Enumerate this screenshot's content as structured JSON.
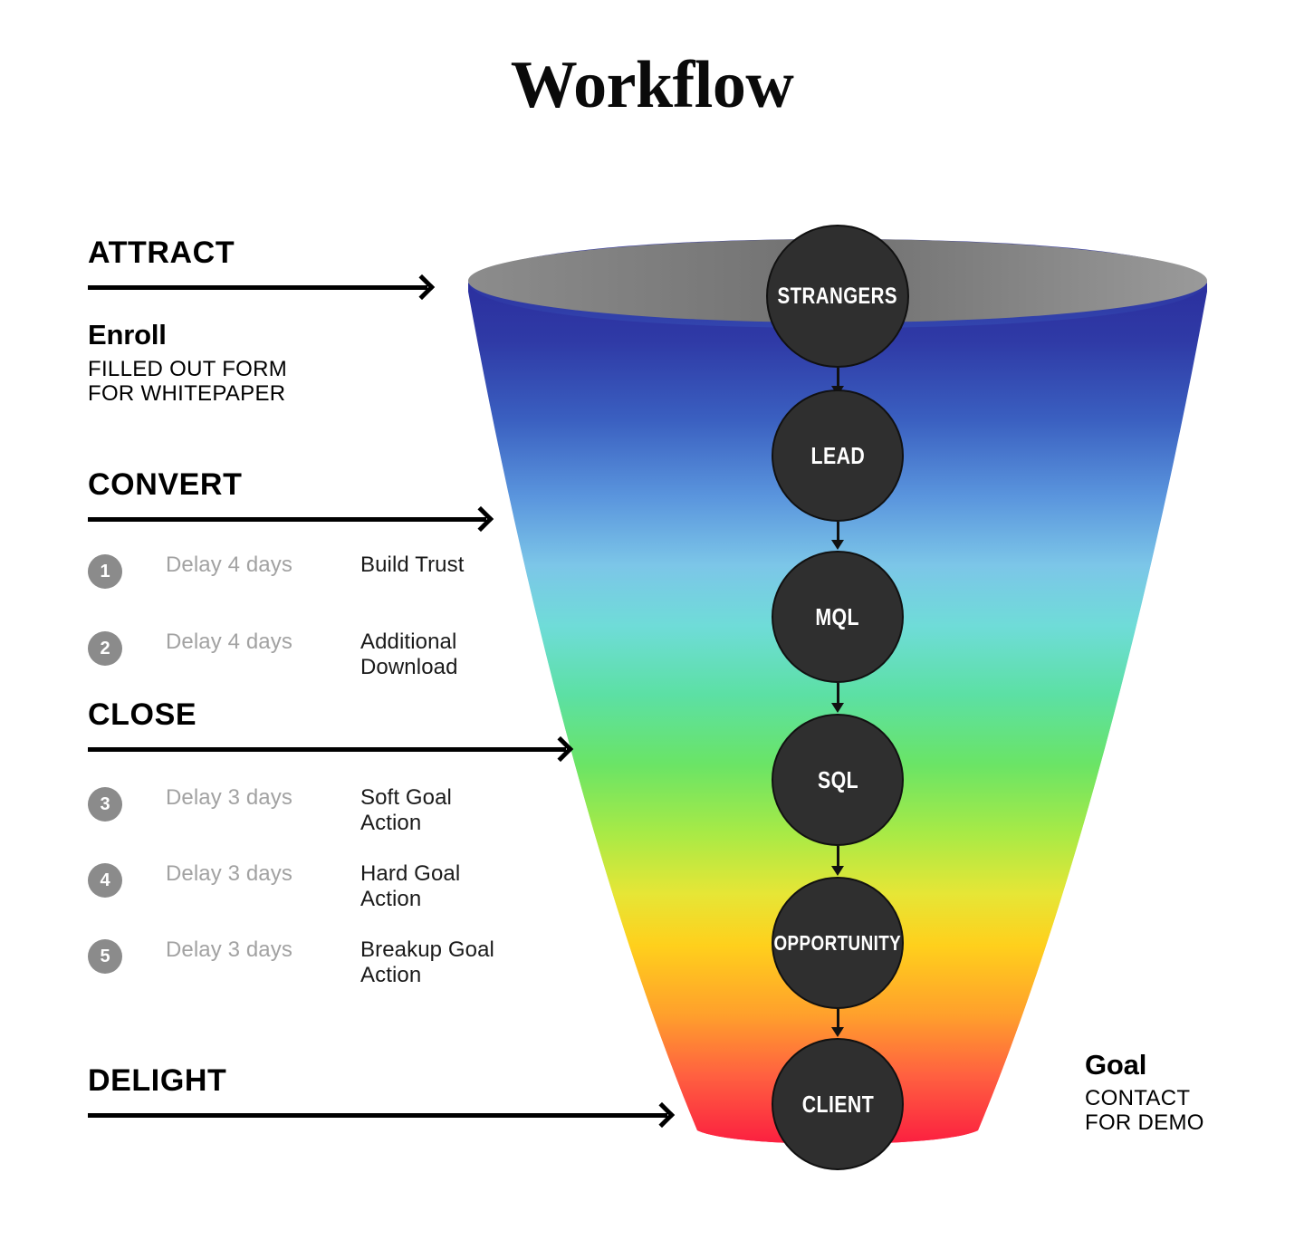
{
  "title": "Workflow",
  "phases": [
    {
      "id": "attract",
      "label": "ATTRACT",
      "arrow_width": 375
    },
    {
      "id": "convert",
      "label": "CONVERT",
      "arrow_width": 440
    },
    {
      "id": "close",
      "label": "CLOSE",
      "arrow_width": 528
    },
    {
      "id": "delight",
      "label": "DELIGHT",
      "arrow_width": 640
    }
  ],
  "enroll": {
    "title": "Enroll",
    "line1": "FILLED OUT FORM",
    "line2": "FOR WHITEPAPER"
  },
  "steps": [
    {
      "number": "1",
      "delay": "Delay 4 days",
      "action_line1": "Build Trust",
      "action_line2": ""
    },
    {
      "number": "2",
      "delay": "Delay 4 days",
      "action_line1": "Additional",
      "action_line2": "Download"
    },
    {
      "number": "3",
      "delay": "Delay 3 days",
      "action_line1": "Soft Goal",
      "action_line2": "Action"
    },
    {
      "number": "4",
      "delay": "Delay 3 days",
      "action_line1": "Hard Goal",
      "action_line2": "Action"
    },
    {
      "number": "5",
      "delay": "Delay 3 days",
      "action_line1": "Breakup Goal",
      "action_line2": "Action"
    }
  ],
  "goal": {
    "title": "Goal",
    "line1": "CONTACT",
    "line2": "FOR DEMO"
  },
  "funnel": {
    "rim_color": "#808080",
    "stages": [
      {
        "id": "strangers",
        "label": "STRANGERS"
      },
      {
        "id": "lead",
        "label": "LEAD"
      },
      {
        "id": "mql",
        "label": "MQL"
      },
      {
        "id": "sql",
        "label": "SQL"
      },
      {
        "id": "opportunity",
        "label": "OPPORTUNITY"
      },
      {
        "id": "client",
        "label": "CLIENT"
      }
    ],
    "gradient_stops": [
      "#2b2f9e",
      "#2f3fa8",
      "#3f6ec8",
      "#6aa8e6",
      "#7fd4e8",
      "#5fe0c8",
      "#5ee08a",
      "#8ce85a",
      "#d8e83c",
      "#ffd11a",
      "#ffa12a",
      "#ff6a3c",
      "#ff3a3a",
      "#fb2040"
    ],
    "circle_fill": "#2f2f2f",
    "circle_stroke": "#111111",
    "label_color": "#ffffff"
  }
}
